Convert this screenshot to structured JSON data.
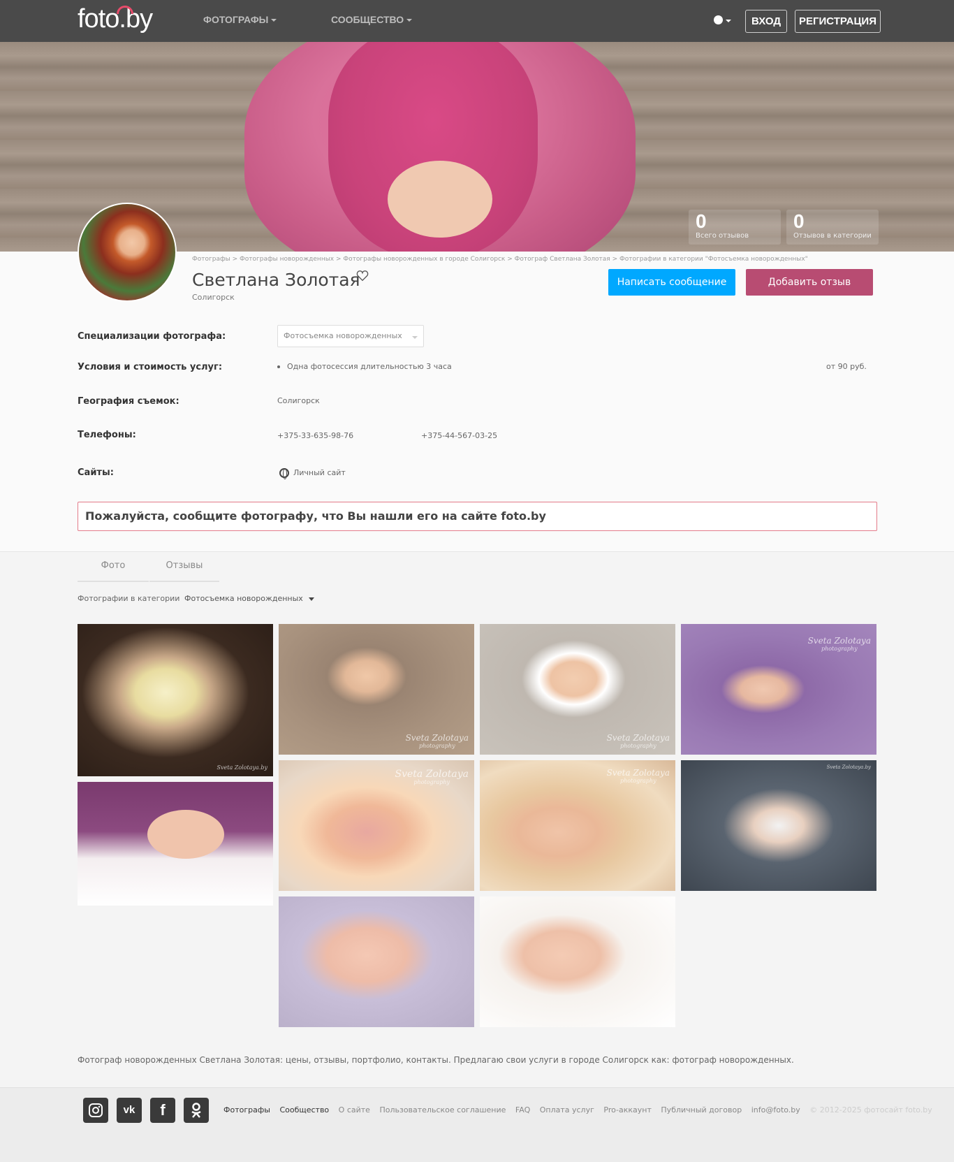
{
  "header": {
    "logo": "foto.by",
    "nav": [
      {
        "label": "ФОТОГРАФЫ"
      },
      {
        "label": "СООБЩЕСТВО"
      }
    ],
    "login": "ВХОД",
    "register": "РЕГИСТРАЦИЯ"
  },
  "stats": [
    {
      "num": "0",
      "label": "Всего отзывов"
    },
    {
      "num": "0",
      "label": "Отзывов в категории"
    }
  ],
  "breadcrumb": "Фотографы > Фотографы новорожденных > Фотографы новорожденных в городе Солигорск > Фотограф Светлана Золотая > Фотографии в категории \"Фотосъемка новорожденных\"",
  "profile": {
    "name": "Светлана Золотая",
    "city": "Солигорск",
    "write_message": "Написать сообщение",
    "add_review": "Добавить отзыв"
  },
  "details": {
    "spec_label": "Специализации фотографа:",
    "spec_value": "Фотосъемка новорожденных",
    "terms_label": "Условия и стоимость услуг:",
    "terms_item": "Одна фотосессия длительностью 3 часа",
    "terms_price": "от 90 руб.",
    "geo_label": "География съемок:",
    "geo_value": "Солигорск",
    "phones_label": "Телефоны:",
    "phone1": "+375-33-635-98-76",
    "phone2": "+375-44-567-03-25",
    "sites_label": "Сайты:",
    "site_value": "Личный сайт"
  },
  "notice": "Пожалуйста, сообщите фотографу, что Вы нашли его на сайте foto.by",
  "tabs": [
    {
      "label": "Фото"
    },
    {
      "label": "Отзывы"
    }
  ],
  "category": {
    "label": "Фотографии в категории",
    "value": "Фотосъемка новорожденных"
  },
  "watermarks": {
    "name": "Sveta Zolotaya",
    "sub": "photography",
    "domain": "Sveta Zolotaya.by"
  },
  "description": "Фотограф новорожденных Светлана Золотая: цены, отзывы, портфолио, контакты. Предлагаю свои услуги в городе Солигорск как: фотограф новорожденных.",
  "footer": {
    "links": [
      "Фотографы",
      "Сообщество",
      "О сайте",
      "Пользовательское соглашение",
      "FAQ",
      "Оплата услуг",
      "Pro-аккаунт",
      "Публичный договор",
      "info@foto.by"
    ],
    "copyright": "© 2012-2025 фотосайт foto.by"
  },
  "social_icons": [
    "instagram-icon",
    "vk-icon",
    "facebook-icon",
    "odnoklassniki-icon"
  ]
}
